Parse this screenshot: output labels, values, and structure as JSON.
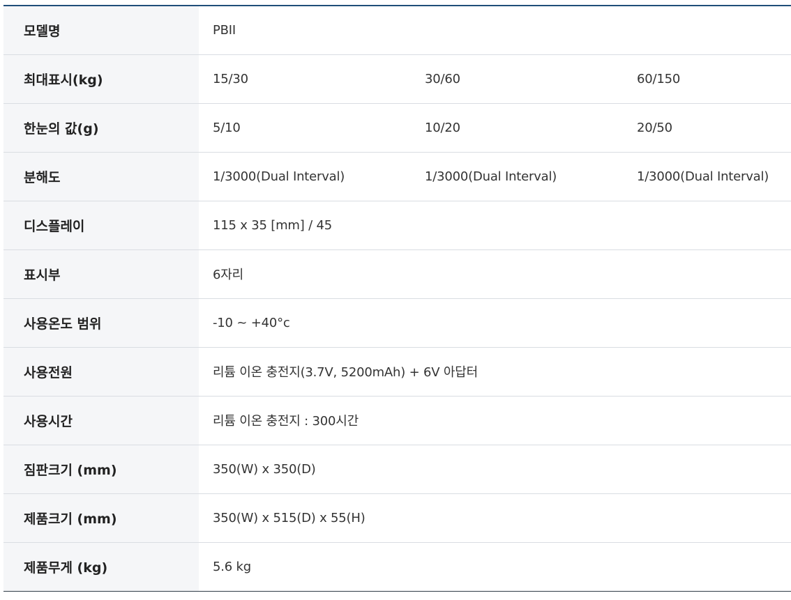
{
  "rows": [
    {
      "label": "모델명",
      "values": [
        "PBII"
      ]
    },
    {
      "label": "최대표시(kg)",
      "values": [
        "15/30",
        "30/60",
        "60/150"
      ]
    },
    {
      "label": "한눈의 값(g)",
      "values": [
        "5/10",
        "10/20",
        "20/50"
      ]
    },
    {
      "label": "분해도",
      "values": [
        "1/3000(Dual Interval)",
        "1/3000(Dual Interval)",
        "1/3000(Dual Interval)"
      ]
    },
    {
      "label": "디스플레이",
      "values": [
        "115 x 35 [mm] / 45"
      ]
    },
    {
      "label": "표시부",
      "values": [
        "6자리"
      ]
    },
    {
      "label": "사용온도 범위",
      "values": [
        "-10 ~ +40°c"
      ]
    },
    {
      "label": "사용전원",
      "values": [
        "리튬 이온 충전지(3.7V, 5200mAh) + 6V 아답터"
      ]
    },
    {
      "label": "사용시간",
      "values": [
        "리튬 이온 충전지 : 300시간"
      ]
    },
    {
      "label": "짐판크기 (mm)",
      "values": [
        "350(W) x 350(D)"
      ]
    },
    {
      "label": "제품크기 (mm)",
      "values": [
        "350(W) x 515(D) x 55(H)"
      ]
    },
    {
      "label": "제품무게 (kg)",
      "values": [
        "5.6 kg"
      ]
    }
  ],
  "colors": {
    "header_bg": "#f5f6f8",
    "top_border": "#1f4e79",
    "row_border": "#d9dde2"
  }
}
